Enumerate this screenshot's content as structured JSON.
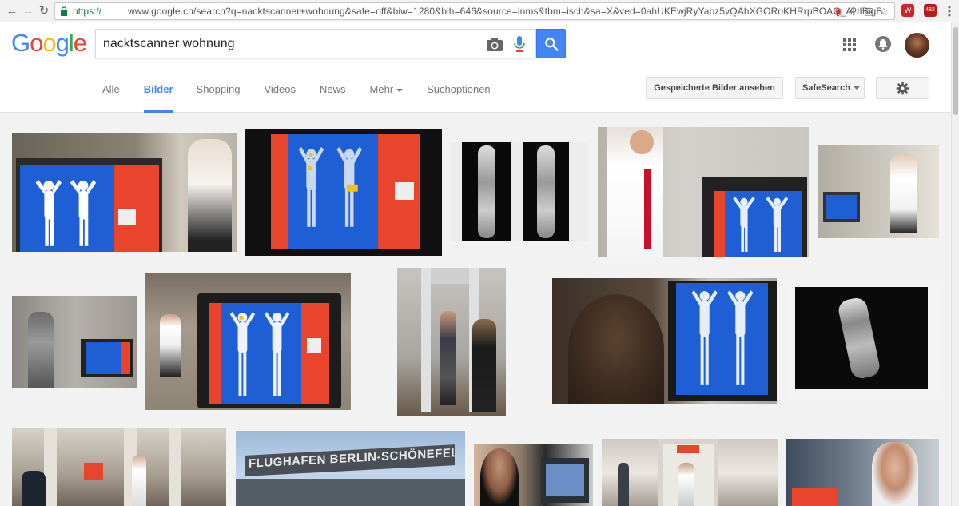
{
  "browser": {
    "url_scheme": "https://",
    "url_rest": "www.google.ch/search?q=nacktscanner+wohnung&safe=off&biw=1280&bih=646&source=lnms&tbm=isch&sa=X&ved=0ahUKEwjRyYabz5vQAhXGORoKHRrpBOAQ_AUIBigB",
    "ext_badge": "482"
  },
  "search": {
    "query": "nacktscanner wohnung"
  },
  "logo": {
    "letters": [
      "G",
      "o",
      "o",
      "g",
      "l",
      "e"
    ],
    "colors": [
      "#4285f4",
      "#ea4335",
      "#fbbc05",
      "#4285f4",
      "#34a853",
      "#ea4335"
    ]
  },
  "tabs": [
    {
      "label": "Alle",
      "active": false
    },
    {
      "label": "Bilder",
      "active": true
    },
    {
      "label": "Shopping",
      "active": false
    },
    {
      "label": "Videos",
      "active": false
    },
    {
      "label": "News",
      "active": false
    },
    {
      "label": "Mehr",
      "active": false
    },
    {
      "label": "Suchoptionen",
      "active": false
    }
  ],
  "toolbar": {
    "saved_images": "Gespeicherte Bilder ansehen",
    "safesearch": "SafeSearch"
  },
  "thumbnails": {
    "airport_sign": "FLUGHAFEN BERLIN-SCHÖNEFELD"
  },
  "colors": {
    "accent": "#4285f4",
    "scanner_blue": "#1f5fd6",
    "scanner_red": "#e8452c"
  }
}
